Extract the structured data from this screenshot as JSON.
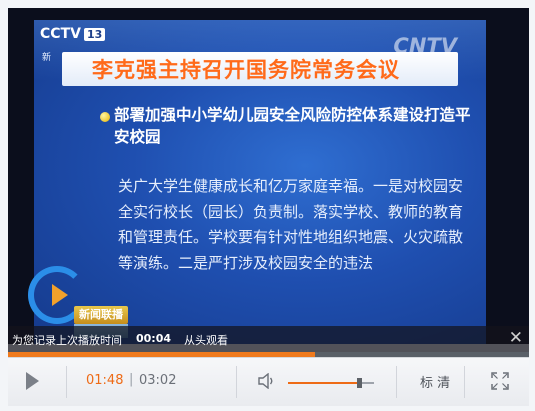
{
  "video": {
    "channel_logo": "CCTV",
    "channel_number": "13",
    "channel_xin": "新",
    "watermark": "CNTV",
    "headline": "李克强主持召开国务院常务会议",
    "bullet": "部署加强中小学幼儿园安全风险防控体系建设打造平安校园",
    "body": "关广大学生健康成长和亿万家庭幸福。一是对校园安全实行校长（园长）负责制。落实学校、教师的教育和管理责任。学校要有针对性地组织地震、火灾疏散等演练。二是严打涉及校园安全的违法",
    "news_tag": "新闻联播"
  },
  "resume": {
    "label": "为您记录上次播放时间",
    "time": "00:04",
    "link": "从头观看",
    "close": "✕"
  },
  "player": {
    "progress": 0.59,
    "current_time": "01:48",
    "divider": "|",
    "total_time": "03:02",
    "volume": 0.82,
    "quality": "标 清"
  },
  "colors": {
    "accent": "#ee6b16",
    "headline": "#ff6a1a",
    "screen_blue": "#1f4fb0"
  }
}
